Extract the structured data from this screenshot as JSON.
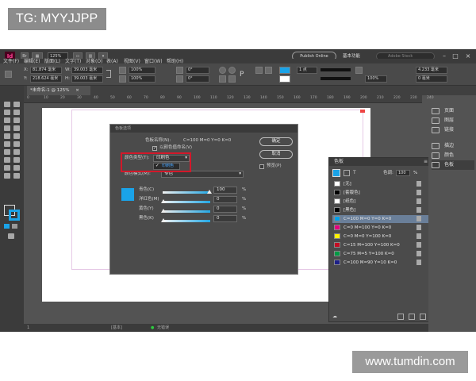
{
  "badge": {
    "text": "TG: MYYJJPP"
  },
  "watermark": {
    "text": "www.tumdin.com"
  },
  "app": {
    "logo": "Id",
    "menu": [
      "文件(F)",
      "编辑(E)",
      "版面(L)",
      "文字(T)",
      "对象(O)",
      "表(A)",
      "视图(V)",
      "窗口(W)",
      "帮助(H)"
    ],
    "zoom": "125%",
    "publish_label": "Publish Online",
    "workspace_label": "基本功能",
    "search_placeholder": "Adobe Stock"
  },
  "control": {
    "x_label": "X:",
    "x_value": "81.874 毫米",
    "y_label": "Y:",
    "y_value": "218.624 毫米",
    "w_label": "W:",
    "w_value": "39.003 毫米",
    "h_label": "H:",
    "h_value": "39.003 毫米",
    "scale_x": "100%",
    "scale_y": "100%",
    "rotate": "0°",
    "shear": "0°",
    "stroke_weight": "1 点",
    "opacity": "100%",
    "offset": "4.233 毫米",
    "gap": "0 毫米"
  },
  "doc": {
    "tab_title": "*未命名-1 @ 125%",
    "close": "×"
  },
  "ruler": [
    "0",
    "10",
    "20",
    "30",
    "40",
    "50",
    "60",
    "70",
    "80",
    "90",
    "100",
    "110",
    "120",
    "130",
    "140",
    "150",
    "160",
    "170",
    "180",
    "190",
    "200",
    "210",
    "220",
    "230",
    "240"
  ],
  "dialog": {
    "title": "色板选项",
    "name_label": "色板名称(N):",
    "name_value": "C=100 M=0 Y=0 K=0",
    "name_by_value_label": "以颜色值命名(V)",
    "name_by_value_checked": "✓",
    "color_type_label": "颜色类型(T):",
    "color_type_value": "印刷色",
    "dropdown_option_checked": "✓",
    "dropdown_option": "印刷色",
    "color_mode_label": "颜色模式(M):",
    "color_mode_value": "专色",
    "ok": "确定",
    "cancel": "取消",
    "preview_label": "预览(P)",
    "swatch_color": "#1aa3e8",
    "sliders": [
      {
        "label": "青色(C)",
        "value": "100",
        "unit": "%",
        "level": 1.0
      },
      {
        "label": "洋红色(M)",
        "value": "0",
        "unit": "%",
        "level": 0.0
      },
      {
        "label": "黄色(Y)",
        "value": "0",
        "unit": "%",
        "level": 0.0
      },
      {
        "label": "黑色(K)",
        "value": "0",
        "unit": "%",
        "level": 0.0
      }
    ]
  },
  "swatches": {
    "title": "色板",
    "tint_label": "色调:",
    "tint_value": "100",
    "tint_unit": "%",
    "items": [
      {
        "name": "[无]",
        "color": "#ffffff"
      },
      {
        "name": "[套版色]",
        "color": "#000000"
      },
      {
        "name": "[纸色]",
        "color": "#ffffff"
      },
      {
        "name": "[黑色]",
        "color": "#000000"
      },
      {
        "name": "C=100 M=0 Y=0 K=0",
        "color": "#00a0e9"
      },
      {
        "name": "C=0 M=100 Y=0 K=0",
        "color": "#e4007f"
      },
      {
        "name": "C=0 M=0 Y=100 K=0",
        "color": "#fff100"
      },
      {
        "name": "C=15 M=100 Y=100 K=0",
        "color": "#c30d23"
      },
      {
        "name": "C=75 M=5 Y=100 K=0",
        "color": "#009a44"
      },
      {
        "name": "C=100 M=90 Y=10 K=0",
        "color": "#1d2088"
      }
    ]
  },
  "dock": [
    {
      "label": "页面"
    },
    {
      "label": "图层"
    },
    {
      "label": "链接"
    },
    {
      "label": "描边"
    },
    {
      "label": "颜色"
    },
    {
      "label": "色板"
    }
  ],
  "status": {
    "page": "1",
    "style": "[基本]",
    "state": "无错误"
  },
  "colors": {
    "fill_swatch": "#1aa3e8",
    "highlight": "#d3182a"
  }
}
